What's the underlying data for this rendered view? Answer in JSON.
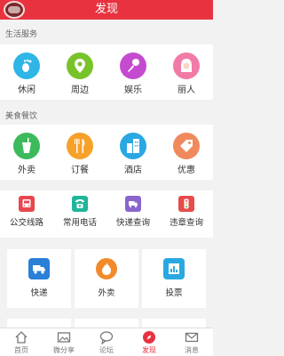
{
  "header": {
    "title": "发现"
  },
  "sections": {
    "life": {
      "title": "生活服务",
      "items": [
        {
          "label": "休闲",
          "icon": "foot-icon",
          "color": "#2fb5e6"
        },
        {
          "label": "周边",
          "icon": "location-pin-icon",
          "color": "#78c32a"
        },
        {
          "label": "娱乐",
          "icon": "microphone-icon",
          "color": "#c44bd0"
        },
        {
          "label": "丽人",
          "icon": "woman-icon",
          "color": "#f27aa6"
        }
      ]
    },
    "food": {
      "title": "美食餐饮",
      "items": [
        {
          "label": "外卖",
          "icon": "drink-icon",
          "color": "#3cba5c"
        },
        {
          "label": "订餐",
          "icon": "fork-knife-icon",
          "color": "#f7a12a"
        },
        {
          "label": "酒店",
          "icon": "building-icon",
          "color": "#2aa8e1"
        },
        {
          "label": "优惠",
          "icon": "tag-icon",
          "color": "#f08a5d"
        }
      ]
    }
  },
  "utilities": [
    {
      "label": "公交线路",
      "icon": "bus-icon",
      "color": "#e8474f"
    },
    {
      "label": "常用电话",
      "icon": "phone-icon",
      "color": "#1fb59a"
    },
    {
      "label": "快递查询",
      "icon": "truck-icon",
      "color": "#8a66cc"
    },
    {
      "label": "违章查询",
      "icon": "traffic-light-icon",
      "color": "#e84b4b"
    }
  ],
  "cards": [
    {
      "label": "快递",
      "icon": "delivery-truck-icon",
      "color": "#2a7fd6"
    },
    {
      "label": "外卖",
      "icon": "flame-icon",
      "color": "#f28a2a"
    },
    {
      "label": "投票",
      "icon": "chart-icon",
      "color": "#2aa8e1"
    }
  ],
  "tabbar": [
    {
      "label": "首页",
      "icon": "home-icon"
    },
    {
      "label": "微分享",
      "icon": "image-icon"
    },
    {
      "label": "论坛",
      "icon": "chat-bubble-icon"
    },
    {
      "label": "发现",
      "icon": "compass-icon",
      "active": true
    },
    {
      "label": "消息",
      "icon": "mail-icon"
    }
  ]
}
